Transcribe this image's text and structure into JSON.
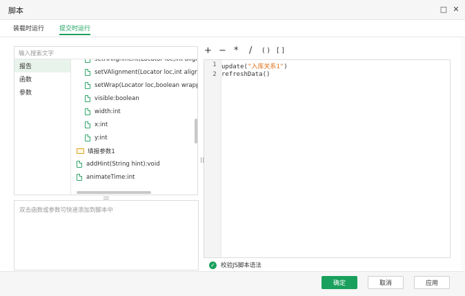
{
  "window": {
    "title": "脚本",
    "controls": {
      "maximize": "□",
      "close": "✕"
    }
  },
  "tabs": [
    {
      "label": "装载时运行",
      "active": false
    },
    {
      "label": "提交时运行",
      "active": true
    }
  ],
  "left_panel": {
    "search_placeholder": "输入搜索文字",
    "categories": [
      {
        "label": "报告",
        "selected": true
      },
      {
        "label": "函数",
        "selected": false
      },
      {
        "label": "参数",
        "selected": false
      }
    ],
    "tree_items": [
      {
        "label": "setHAlignment(Locator loc,int align):v",
        "type": "file",
        "indent": true
      },
      {
        "label": "setVAlignment(Locator loc,int align):v",
        "type": "file",
        "indent": true
      },
      {
        "label": "setWrap(Locator loc,boolean wrapped",
        "type": "file",
        "indent": true
      },
      {
        "label": "visible:boolean",
        "type": "file",
        "indent": true
      },
      {
        "label": "width:int",
        "type": "file",
        "indent": true
      },
      {
        "label": "x:int",
        "type": "file",
        "indent": true
      },
      {
        "label": "y:int",
        "type": "file",
        "indent": true
      },
      {
        "label": "填报参数1",
        "type": "folder",
        "indent": false
      },
      {
        "label": "addHint(String hint):void",
        "type": "file",
        "indent": false
      },
      {
        "label": "animateTime:int",
        "type": "file",
        "indent": false
      }
    ],
    "description_hint": "双击函数或参数可快速添加到脚本中"
  },
  "operators": [
    "+",
    "−",
    "*",
    "/",
    "( )",
    "[ ]"
  ],
  "editor": {
    "lines": [
      {
        "num": "1",
        "prefix": "update(",
        "string": "\"入库关系1\"",
        "suffix": ")"
      },
      {
        "num": "2",
        "prefix": "refreshData()",
        "string": "",
        "suffix": ""
      }
    ]
  },
  "validate": {
    "label": "校验JS脚本语法",
    "icon": "check-circle-icon"
  },
  "footer": {
    "ok": "确定",
    "cancel": "取消",
    "apply": "应用"
  },
  "colors": {
    "accent": "#1aa05d",
    "string": "#e0701a"
  }
}
